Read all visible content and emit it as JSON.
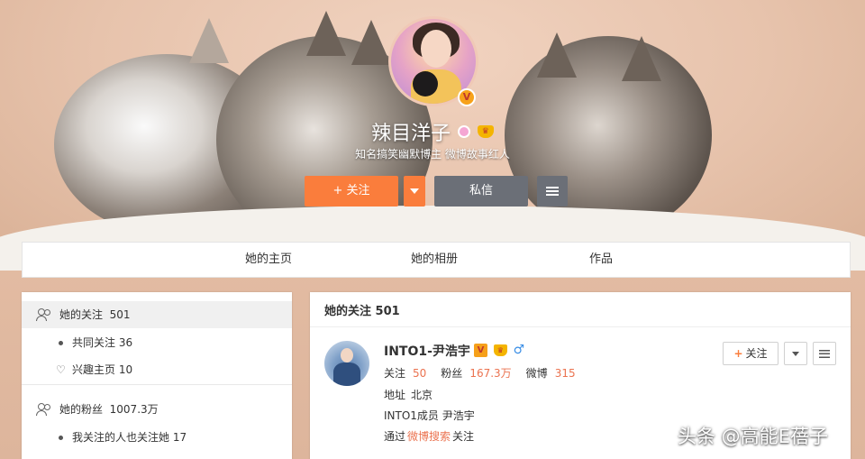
{
  "profile": {
    "name": "辣目洋子",
    "description": "知名搞笑幽默博主 微博故事红人",
    "verified_glyph": "V",
    "crown_glyph": "♛"
  },
  "actions": {
    "follow_label": "+ 关注",
    "message_label": "私信"
  },
  "tabs": [
    {
      "label": "她的主页"
    },
    {
      "label": "她的相册"
    },
    {
      "label": "作品"
    }
  ],
  "sidebar": {
    "following": {
      "label": "她的关注",
      "count": "501"
    },
    "mutual_following": {
      "label": "共同关注",
      "count": "36"
    },
    "interest_home": {
      "label": "兴趣主页",
      "count": "10"
    },
    "fans": {
      "label": "她的粉丝",
      "count": "1007.3万"
    },
    "followed_by_my_follows": {
      "label": "我关注的人也关注她",
      "count": "17"
    }
  },
  "main": {
    "title": "她的关注 501",
    "user": {
      "name": "INTO1-尹浩宇",
      "verified_glyph": "V",
      "crown_glyph": "♛",
      "gender_glyph": "♂",
      "stats": {
        "following_label": "关注",
        "following": "50",
        "fans_label": "粉丝",
        "fans": "167.3万",
        "posts_label": "微博",
        "posts": "315"
      },
      "address_label": "地址",
      "address": "北京",
      "intro": "INTO1成员 尹浩宇",
      "via_prefix": "通过",
      "via_link": "微博搜索",
      "via_suffix": "关注",
      "follow_button": "关注",
      "follow_plus": "+"
    }
  },
  "watermark": "头条 @高能E蓓子",
  "colors": {
    "accent_orange": "#fa7d3c",
    "link_orange": "#eb7350",
    "button_gray": "#6b6f77"
  }
}
